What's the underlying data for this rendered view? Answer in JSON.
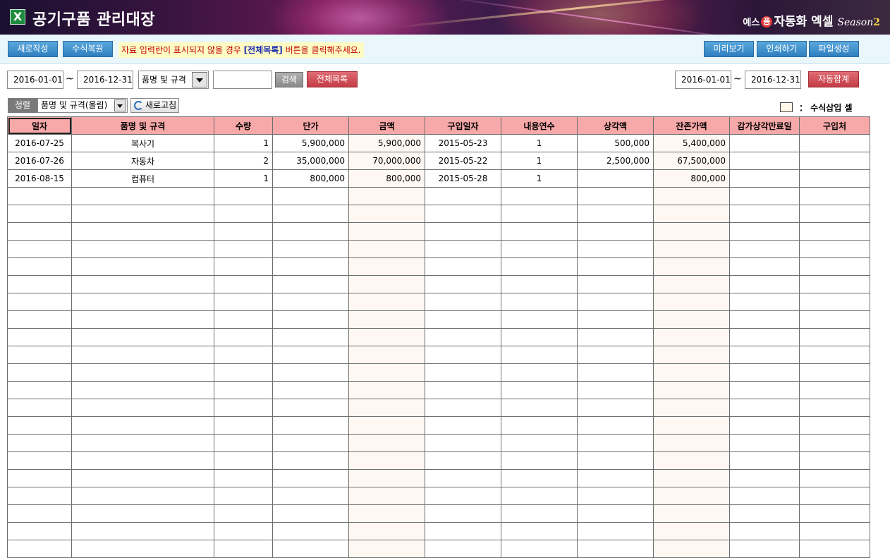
{
  "header": {
    "app_icon": "excel-x-icon",
    "title": "공기구품 관리대장",
    "brand": {
      "pre": "예스",
      "plus": "폼",
      "main": "자동화 엑셀",
      "season": "Season",
      "num": "2"
    }
  },
  "toolbar": {
    "new_label": "새로작성",
    "restore_label": "수식복원",
    "notice_pre": "자료 입력란이 표시되지  않을 경우 ",
    "notice_em": "[전체목록]",
    "notice_post": " 버튼을 클릭해주세요.",
    "preview_label": "미리보기",
    "print_label": "인쇄하기",
    "file_label": "파일생성"
  },
  "filter": {
    "date_from": "2016-01-01",
    "tilde": "~",
    "date_to": "2016-12-31",
    "search_field": "품명 및 규격",
    "search_text": "",
    "search_label": "검색",
    "all_list_label": "전체목록",
    "sum_date_from": "2016-01-01",
    "sum_date_to": "2016-12-31",
    "auto_sum_label": "자동합계"
  },
  "sort": {
    "label": "정렬",
    "value": "품명 및 규격(올림)",
    "refresh_label": "새로고침",
    "legend_text": "： 수식삽입 셀"
  },
  "table": {
    "columns": [
      "일자",
      "품명 및 규격",
      "수량",
      "단가",
      "금액",
      "구입일자",
      "내용연수",
      "상각액",
      "잔존가액",
      "감가상각만료일",
      "구입처"
    ],
    "rows": [
      [
        "2016-07-25",
        "복사기",
        "1",
        "5,900,000",
        "5,900,000",
        "2015-05-23",
        "1",
        "500,000",
        "5,400,000",
        "",
        ""
      ],
      [
        "2016-07-26",
        "자동차",
        "2",
        "35,000,000",
        "70,000,000",
        "2015-05-22",
        "1",
        "2,500,000",
        "67,500,000",
        "",
        ""
      ],
      [
        "2016-08-15",
        "컴퓨터",
        "1",
        "800,000",
        "800,000",
        "2015-05-28",
        "1",
        "",
        "800,000",
        "",
        ""
      ]
    ],
    "empty_rows": 21,
    "formula_cell_color": "#fff8f2",
    "header_color": "#f7a8a8"
  }
}
